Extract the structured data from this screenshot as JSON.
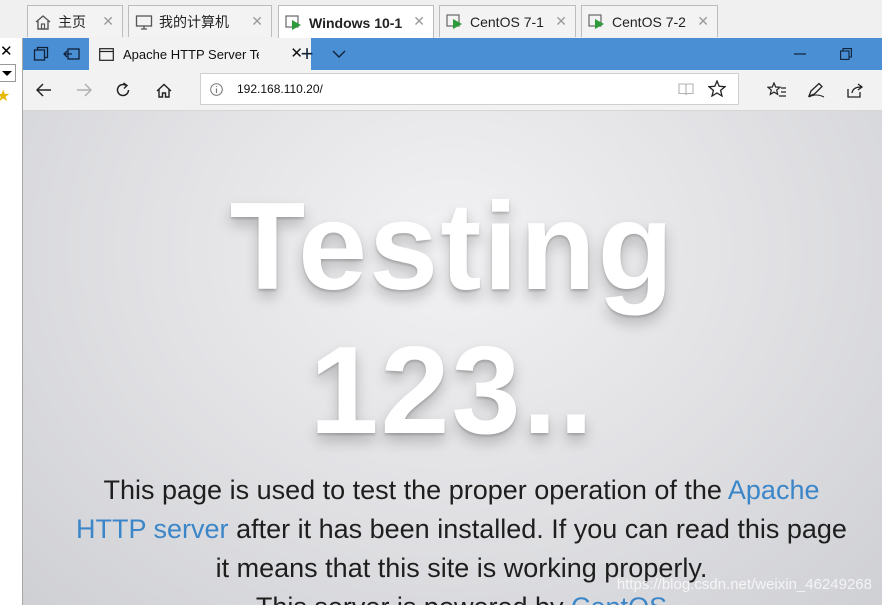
{
  "vm_tabs": [
    {
      "label": "主页",
      "active": false
    },
    {
      "label": "我的计算机",
      "active": false
    },
    {
      "label": "Windows 10-1",
      "active": true
    },
    {
      "label": "CentOS 7-1",
      "active": false
    },
    {
      "label": "CentOS 7-2",
      "active": false
    }
  ],
  "edge": {
    "tab_title": "Apache HTTP Server Tes",
    "url": "192.168.110.20/"
  },
  "page": {
    "hero_line1": "Testing",
    "hero_line2": "123..",
    "p1_text1": "This page is used to test the proper operation of the",
    "p1_link": "Apache HTTP server",
    "p1_text2": " after it has been installed. If you can read this page it means that this site is working properly.",
    "p2_text": "This server is powered by ",
    "p2_link": "CentOS",
    "watermark": "https://blog.csdn.net/weixin_46249268"
  },
  "colors": {
    "vm_active_tab": "#ffffff",
    "edge_titlebar": "#4a8fd3",
    "link": "#3b86c8",
    "vm_play_icon": "#2f9a3a"
  },
  "icons": {
    "home_tab": "house-icon",
    "computer_tab": "monitor-icon",
    "vm_tabs": "vm-play-icon"
  }
}
